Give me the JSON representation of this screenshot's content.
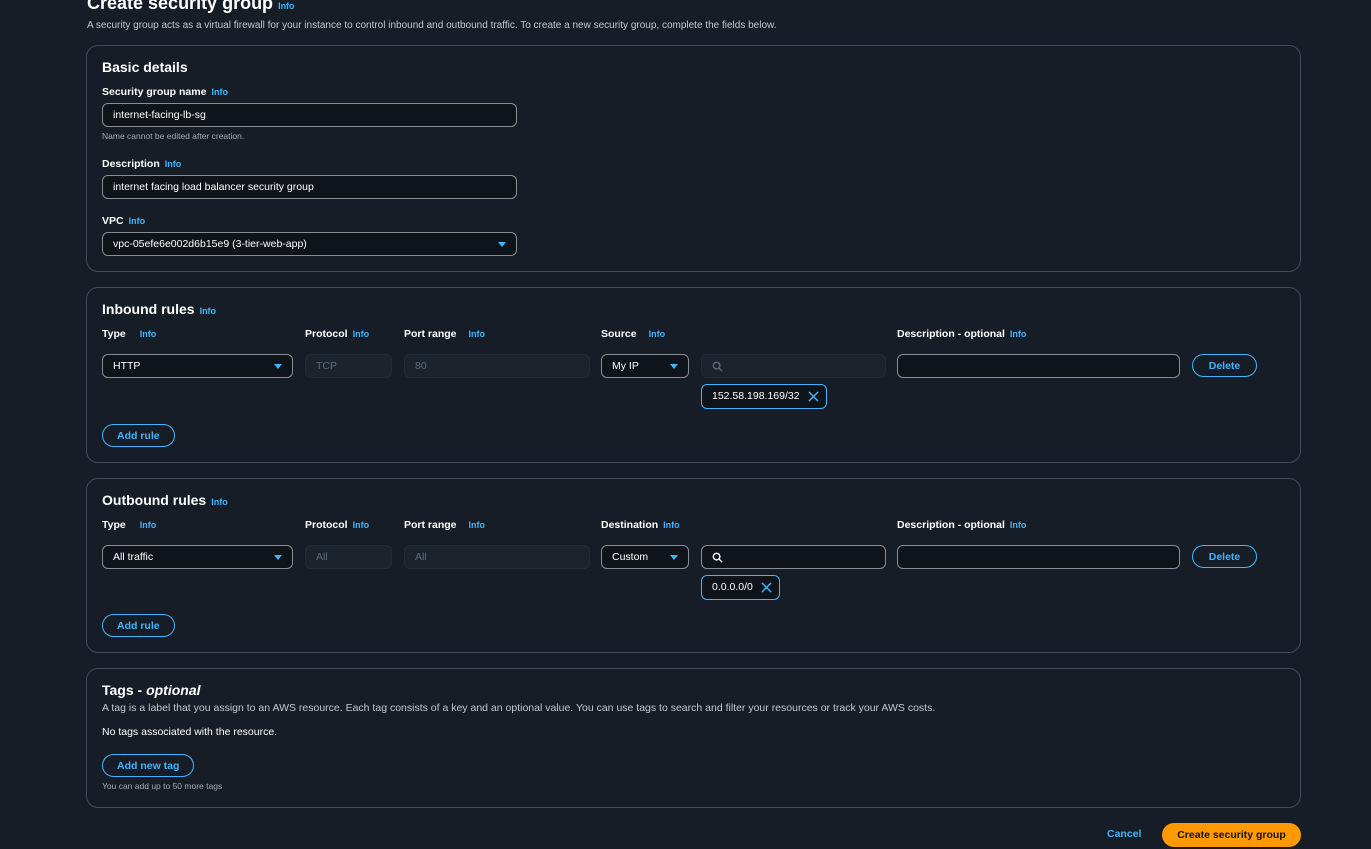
{
  "page": {
    "title": "Create security group",
    "info": "Info",
    "description": "A security group acts as a virtual firewall for your instance to control inbound and outbound traffic. To create a new security group, complete the fields below."
  },
  "basic": {
    "title": "Basic details",
    "name_label": "Security group name",
    "name_info": "Info",
    "name_value": "internet-facing-lb-sg",
    "name_hint": "Name cannot be edited after creation.",
    "desc_label": "Description",
    "desc_info": "Info",
    "desc_value": "internet facing load balancer security group",
    "vpc_label": "VPC",
    "vpc_info": "Info",
    "vpc_value": "vpc-05efe6e002d6b15e9 (3-tier-web-app)"
  },
  "inbound": {
    "title": "Inbound rules",
    "info": "Info",
    "headers": {
      "type": "Type",
      "type_info": "Info",
      "protocol": "Protocol",
      "protocol_info": "Info",
      "port": "Port range",
      "port_info": "Info",
      "source": "Source",
      "source_info": "Info",
      "desc": "Description - optional",
      "desc_info": "Info"
    },
    "rule": {
      "type": "HTTP",
      "protocol": "TCP",
      "port": "80",
      "source": "My IP",
      "search_value": "",
      "token": "152.58.198.169/32",
      "description": ""
    },
    "delete_label": "Delete",
    "add_rule_label": "Add rule"
  },
  "outbound": {
    "title": "Outbound rules",
    "info": "Info",
    "headers": {
      "type": "Type",
      "type_info": "Info",
      "protocol": "Protocol",
      "protocol_info": "Info",
      "port": "Port range",
      "port_info": "Info",
      "destination": "Destination",
      "destination_info": "Info",
      "desc": "Description - optional",
      "desc_info": "Info"
    },
    "rule": {
      "type": "All traffic",
      "protocol": "All",
      "port": "All",
      "destination": "Custom",
      "search_value": "",
      "token": "0.0.0.0/0",
      "description": ""
    },
    "delete_label": "Delete",
    "add_rule_label": "Add rule"
  },
  "tags": {
    "title": "Tags - ",
    "title_optional": "optional",
    "description": "A tag is a label that you assign to an AWS resource. Each tag consists of a key and an optional value. You can use tags to search and filter your resources or track your AWS costs.",
    "empty": "No tags associated with the resource.",
    "add_label": "Add new tag",
    "hint": "You can add up to 50 more tags"
  },
  "footer": {
    "cancel_label": "Cancel",
    "create_label": "Create security group"
  },
  "colors": {
    "accent": "#42b4ff",
    "primary": "#ff9900",
    "background": "#161d26"
  }
}
